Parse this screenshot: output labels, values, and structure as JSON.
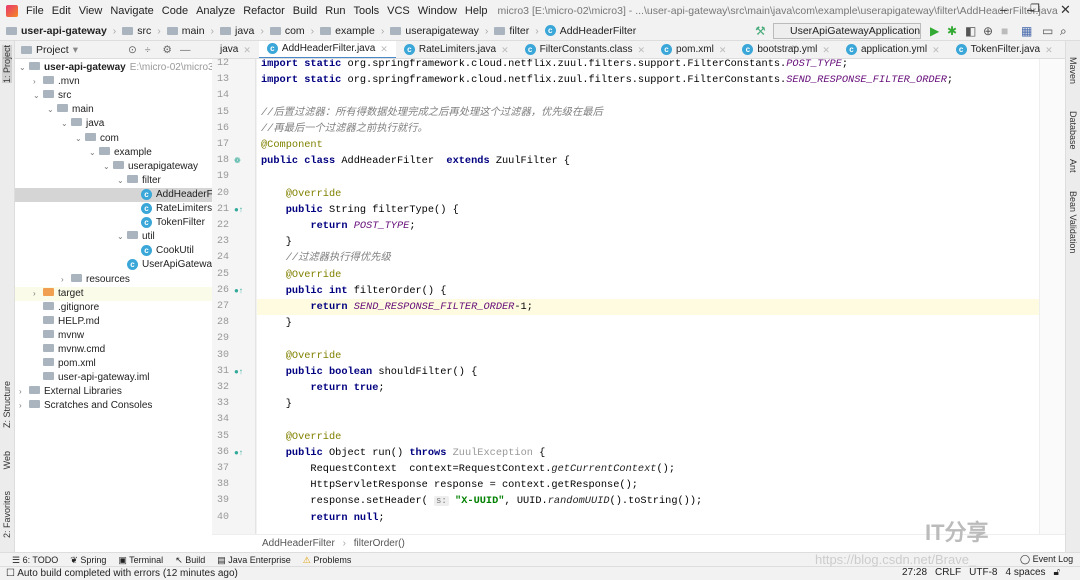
{
  "menu": [
    "File",
    "Edit",
    "View",
    "Navigate",
    "Code",
    "Analyze",
    "Refactor",
    "Build",
    "Run",
    "Tools",
    "VCS",
    "Window",
    "Help"
  ],
  "window_title": "micro3 [E:\\micro-02\\micro3] - ...\\user-api-gateway\\src\\main\\java\\com\\example\\userapigateway\\filter\\AddHeaderFilter.java",
  "nav": [
    "user-api-gateway",
    "src",
    "main",
    "java",
    "com",
    "example",
    "userapigateway",
    "filter",
    "AddHeaderFilter"
  ],
  "run_config": "UserApiGatewayApplication",
  "project_header": "Project",
  "left_strip": [
    "1: Project",
    "Z: Structure",
    "Web",
    "2: Favorites"
  ],
  "right_strip": [
    "Maven",
    "Database",
    "Ant",
    "Bean Validation"
  ],
  "tree": [
    {
      "d": 0,
      "a": "v",
      "label": "user-api-gateway",
      "extra": "E:\\micro-02\\micro3\\u",
      "bold": true
    },
    {
      "d": 1,
      "a": ">",
      "label": ".mvn"
    },
    {
      "d": 1,
      "a": "v",
      "label": "src"
    },
    {
      "d": 2,
      "a": "v",
      "label": "main"
    },
    {
      "d": 3,
      "a": "v",
      "label": "java"
    },
    {
      "d": 4,
      "a": "v",
      "label": "com"
    },
    {
      "d": 5,
      "a": "v",
      "label": "example"
    },
    {
      "d": 6,
      "a": "v",
      "label": "userapigateway"
    },
    {
      "d": 7,
      "a": "v",
      "label": "filter"
    },
    {
      "d": 8,
      "a": "",
      "label": "AddHeaderFi",
      "cls": true,
      "sel": true
    },
    {
      "d": 8,
      "a": "",
      "label": "RateLimiters",
      "cls": true
    },
    {
      "d": 8,
      "a": "",
      "label": "TokenFilter",
      "cls": true
    },
    {
      "d": 7,
      "a": "v",
      "label": "util"
    },
    {
      "d": 8,
      "a": "",
      "label": "CookUtil",
      "cls": true
    },
    {
      "d": 7,
      "a": "",
      "label": "UserApiGateway",
      "cls": true
    },
    {
      "d": 3,
      "a": ">",
      "label": "resources"
    },
    {
      "d": 1,
      "a": ">",
      "label": "target",
      "tgt": true
    },
    {
      "d": 1,
      "a": "",
      "label": ".gitignore"
    },
    {
      "d": 1,
      "a": "",
      "label": "HELP.md"
    },
    {
      "d": 1,
      "a": "",
      "label": "mvnw"
    },
    {
      "d": 1,
      "a": "",
      "label": "mvnw.cmd"
    },
    {
      "d": 1,
      "a": "",
      "label": "pom.xml"
    },
    {
      "d": 1,
      "a": "",
      "label": "user-api-gateway.iml"
    },
    {
      "d": 0,
      "a": ">",
      "label": "External Libraries"
    },
    {
      "d": 0,
      "a": ">",
      "label": "Scratches and Consoles"
    }
  ],
  "tabs": [
    {
      "label": "java"
    },
    {
      "label": "AddHeaderFilter.java",
      "active": true
    },
    {
      "label": "RateLimiters.java"
    },
    {
      "label": "FilterConstants.class"
    },
    {
      "label": "pom.xml"
    },
    {
      "label": "bootstrap.yml"
    },
    {
      "label": "application.yml"
    },
    {
      "label": "TokenFilter.java"
    },
    {
      "label": "CookUtil.java"
    },
    {
      "label": "Mav"
    }
  ],
  "code": {
    "first_line": 12,
    "current_line": 27,
    "lines": [
      [
        [
          "kw",
          "import static "
        ],
        [
          "plain",
          "org.springframework.cloud.netflix.zuul.filters.support.FilterConstants."
        ],
        [
          "cst",
          "POST_TYPE"
        ],
        [
          "plain",
          ";"
        ]
      ],
      [
        [
          "kw",
          "import static "
        ],
        [
          "plain",
          "org.springframework.cloud.netflix.zuul.filters.support.FilterConstants."
        ],
        [
          "cst",
          "SEND_RESPONSE_FILTER_ORDER"
        ],
        [
          "plain",
          ";"
        ]
      ],
      [],
      [
        [
          "cmt",
          "//后置过滤器：所有得数据处理完成之后再处理这个过滤器，优先级在最后"
        ]
      ],
      [
        [
          "cmt",
          "//再最后一个过滤器之前执行就行。"
        ]
      ],
      [
        [
          "ann",
          "@Component"
        ]
      ],
      [
        [
          "kw",
          "public class "
        ],
        [
          "plain",
          "AddHeaderFilter  "
        ],
        [
          "kw",
          "extends "
        ],
        [
          "plain",
          "ZuulFilter {"
        ]
      ],
      [],
      [
        [
          "plain",
          "    "
        ],
        [
          "ann",
          "@Override"
        ]
      ],
      [
        [
          "plain",
          "    "
        ],
        [
          "kw",
          "public "
        ],
        [
          "plain",
          "String filterType() {"
        ]
      ],
      [
        [
          "plain",
          "        "
        ],
        [
          "kw",
          "return "
        ],
        [
          "cst",
          "POST_TYPE"
        ],
        [
          "plain",
          ";"
        ]
      ],
      [
        [
          "plain",
          "    }"
        ]
      ],
      [
        [
          "plain",
          "    "
        ],
        [
          "cmt",
          "//过滤器执行得优先级"
        ]
      ],
      [
        [
          "plain",
          "    "
        ],
        [
          "ann",
          "@Override"
        ]
      ],
      [
        [
          "plain",
          "    "
        ],
        [
          "kw",
          "public int "
        ],
        [
          "plain",
          "filterOrder() {"
        ]
      ],
      [
        [
          "plain",
          "        "
        ],
        [
          "kw",
          "return "
        ],
        [
          "cst",
          "SEND_RESPONSE_FILTER_ORDER"
        ],
        [
          "plain",
          "-1;"
        ]
      ],
      [
        [
          "plain",
          "    }"
        ]
      ],
      [],
      [
        [
          "plain",
          "    "
        ],
        [
          "ann",
          "@Override"
        ]
      ],
      [
        [
          "plain",
          "    "
        ],
        [
          "kw",
          "public boolean "
        ],
        [
          "plain",
          "shouldFilter() {"
        ]
      ],
      [
        [
          "plain",
          "        "
        ],
        [
          "kw",
          "return true"
        ],
        [
          "plain",
          ";"
        ]
      ],
      [
        [
          "plain",
          "    }"
        ]
      ],
      [],
      [
        [
          "plain",
          "    "
        ],
        [
          "ann",
          "@Override"
        ]
      ],
      [
        [
          "plain",
          "    "
        ],
        [
          "kw",
          "public "
        ],
        [
          "plain",
          "Object run() "
        ],
        [
          "kw",
          "throws "
        ],
        [
          "exc",
          "ZuulException"
        ],
        [
          "plain",
          " {"
        ]
      ],
      [
        [
          "plain",
          "        RequestContext  context=RequestContext."
        ],
        [
          "ital",
          "getCurrentContext"
        ],
        [
          "plain",
          "();"
        ]
      ],
      [
        [
          "plain",
          "        HttpServletResponse response = context.getResponse();"
        ]
      ],
      [
        [
          "plain",
          "        response.setHeader( "
        ],
        [
          "hint",
          "s:"
        ],
        [
          "plain",
          " "
        ],
        [
          "str",
          "\"X-UUID\""
        ],
        [
          "plain",
          ", UUID."
        ],
        [
          "ital",
          "randomUUID"
        ],
        [
          "plain",
          "().toString());"
        ]
      ],
      [
        [
          "plain",
          "        "
        ],
        [
          "kw",
          "return null"
        ],
        [
          "plain",
          ";"
        ]
      ]
    ],
    "override_lines": [
      21,
      26,
      31,
      36
    ],
    "bean_line": 18
  },
  "editor_breadcrumb": [
    "AddHeaderFilter",
    "filterOrder()"
  ],
  "tool_windows": [
    "6: TODO",
    "Spring",
    "Terminal",
    "Build",
    "Java Enterprise",
    "Problems"
  ],
  "event_log": "Event Log",
  "status": {
    "message": "Auto build completed with errors (12 minutes ago)",
    "position": "27:28",
    "line_sep": "CRLF",
    "encoding": "UTF-8",
    "indent": "4 spaces"
  },
  "watermark": "IT分享",
  "watermark_url": "https://blog.csdn.net/Brave_"
}
